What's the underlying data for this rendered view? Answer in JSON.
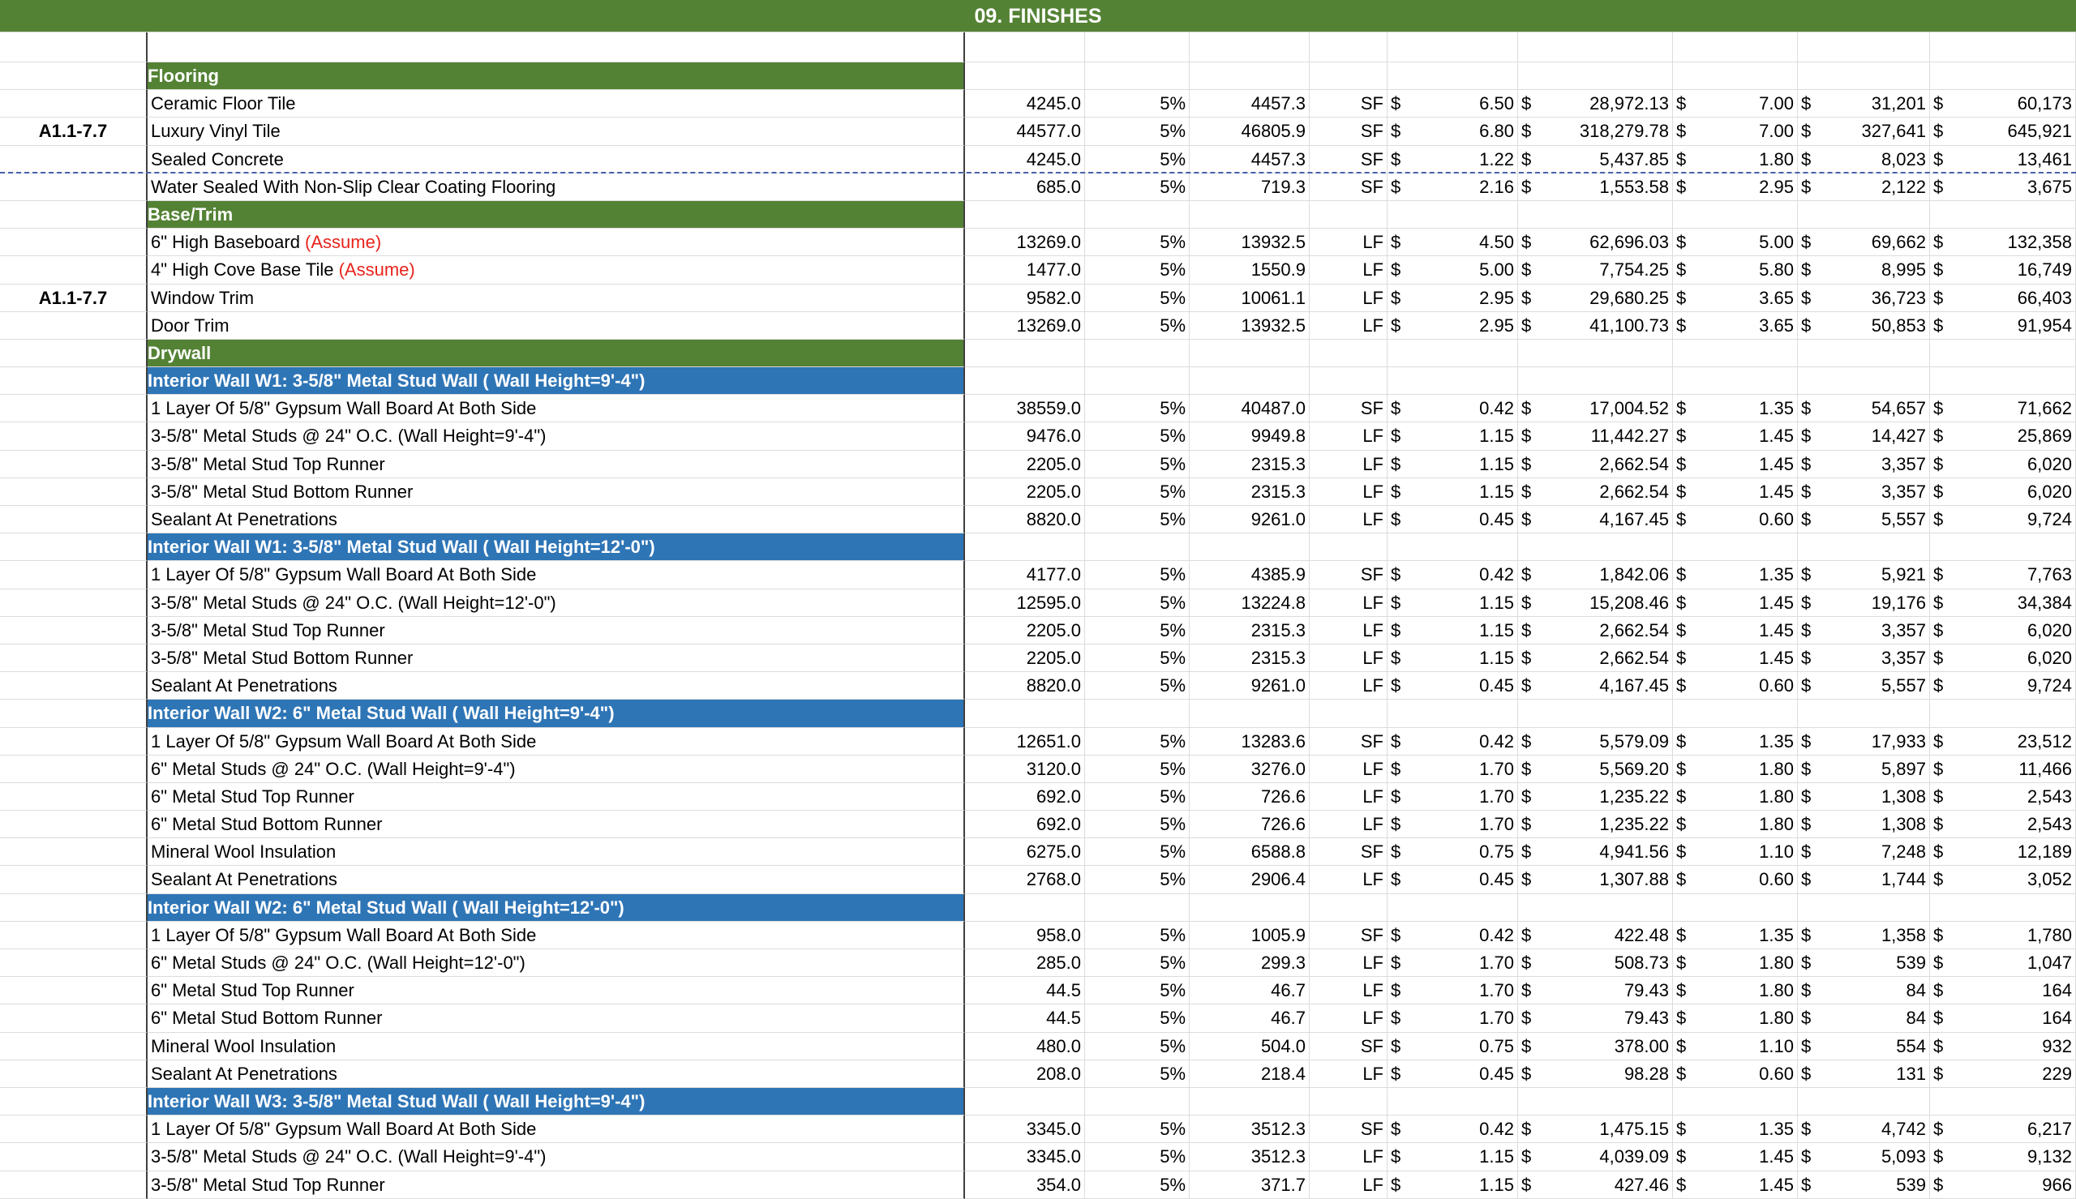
{
  "sheet_title": "09. FINISHES",
  "colors": {
    "section_header": "#548235",
    "subsection_header": "#2e75b6",
    "note": "#e8231b"
  },
  "rows": [
    {
      "kind": "cat",
      "label": "Flooring"
    },
    {
      "kind": "item",
      "ref": "",
      "label": "Ceramic Floor Tile",
      "note": "",
      "qty": "4245.0",
      "waste": "5%",
      "adj": "4457.3",
      "unit": "SF",
      "mat_rate": "6.50",
      "mat_total": "28,972.13",
      "lab_rate": "7.00",
      "lab_total": "31,201",
      "total": "60,173"
    },
    {
      "kind": "item",
      "ref": "A1.1-7.7",
      "label": "Luxury Vinyl Tile",
      "note": "",
      "qty": "44577.0",
      "waste": "5%",
      "adj": "46805.9",
      "unit": "SF",
      "mat_rate": "6.80",
      "mat_total": "318,279.78",
      "lab_rate": "7.00",
      "lab_total": "327,641",
      "total": "645,921"
    },
    {
      "kind": "item",
      "ref": "",
      "label": "Sealed Concrete",
      "note": "",
      "qty": "4245.0",
      "waste": "5%",
      "adj": "4457.3",
      "unit": "SF",
      "mat_rate": "1.22",
      "mat_total": "5,437.85",
      "lab_rate": "1.80",
      "lab_total": "8,023",
      "total": "13,461",
      "dash": true
    },
    {
      "kind": "item",
      "ref": "",
      "label": "Water Sealed With Non-Slip Clear Coating Flooring",
      "note": "",
      "qty": "685.0",
      "waste": "5%",
      "adj": "719.3",
      "unit": "SF",
      "mat_rate": "2.16",
      "mat_total": "1,553.58",
      "lab_rate": "2.95",
      "lab_total": "2,122",
      "total": "3,675"
    },
    {
      "kind": "cat",
      "label": "Base/Trim"
    },
    {
      "kind": "item",
      "ref": "",
      "label": "6\" High Baseboard ",
      "note": "(Assume)",
      "qty": "13269.0",
      "waste": "5%",
      "adj": "13932.5",
      "unit": "LF",
      "mat_rate": "4.50",
      "mat_total": "62,696.03",
      "lab_rate": "5.00",
      "lab_total": "69,662",
      "total": "132,358"
    },
    {
      "kind": "item",
      "ref": "",
      "label": "4\" High Cove Base Tile ",
      "note": "(Assume)",
      "qty": "1477.0",
      "waste": "5%",
      "adj": "1550.9",
      "unit": "LF",
      "mat_rate": "5.00",
      "mat_total": "7,754.25",
      "lab_rate": "5.80",
      "lab_total": "8,995",
      "total": "16,749"
    },
    {
      "kind": "item",
      "ref": "A1.1-7.7",
      "label": "Window Trim",
      "note": "",
      "qty": "9582.0",
      "waste": "5%",
      "adj": "10061.1",
      "unit": "LF",
      "mat_rate": "2.95",
      "mat_total": "29,680.25",
      "lab_rate": "3.65",
      "lab_total": "36,723",
      "total": "66,403"
    },
    {
      "kind": "item",
      "ref": "",
      "label": "Door Trim",
      "note": "",
      "qty": "13269.0",
      "waste": "5%",
      "adj": "13932.5",
      "unit": "LF",
      "mat_rate": "2.95",
      "mat_total": "41,100.73",
      "lab_rate": "3.65",
      "lab_total": "50,853",
      "total": "91,954"
    },
    {
      "kind": "cat",
      "label": "Drywall"
    },
    {
      "kind": "sub",
      "label": "Interior Wall W1: 3-5/8\" Metal Stud Wall ( Wall Height=9'-4\")"
    },
    {
      "kind": "item",
      "ref": "",
      "label": "1 Layer Of  5/8\" Gypsum Wall Board At Both Side",
      "note": "",
      "qty": "38559.0",
      "waste": "5%",
      "adj": "40487.0",
      "unit": "SF",
      "mat_rate": "0.42",
      "mat_total": "17,004.52",
      "lab_rate": "1.35",
      "lab_total": "54,657",
      "total": "71,662"
    },
    {
      "kind": "item",
      "ref": "",
      "label": "3-5/8\" Metal Studs @ 24\" O.C. (Wall Height=9'-4\")",
      "note": "",
      "qty": "9476.0",
      "waste": "5%",
      "adj": "9949.8",
      "unit": "LF",
      "mat_rate": "1.15",
      "mat_total": "11,442.27",
      "lab_rate": "1.45",
      "lab_total": "14,427",
      "total": "25,869"
    },
    {
      "kind": "item",
      "ref": "",
      "label": "3-5/8\" Metal Stud Top Runner",
      "note": "",
      "qty": "2205.0",
      "waste": "5%",
      "adj": "2315.3",
      "unit": "LF",
      "mat_rate": "1.15",
      "mat_total": "2,662.54",
      "lab_rate": "1.45",
      "lab_total": "3,357",
      "total": "6,020"
    },
    {
      "kind": "item",
      "ref": "",
      "label": "3-5/8\" Metal Stud Bottom Runner",
      "note": "",
      "qty": "2205.0",
      "waste": "5%",
      "adj": "2315.3",
      "unit": "LF",
      "mat_rate": "1.15",
      "mat_total": "2,662.54",
      "lab_rate": "1.45",
      "lab_total": "3,357",
      "total": "6,020"
    },
    {
      "kind": "item",
      "ref": "",
      "label": "Sealant At Penetrations",
      "note": "",
      "qty": "8820.0",
      "waste": "5%",
      "adj": "9261.0",
      "unit": "LF",
      "mat_rate": "0.45",
      "mat_total": "4,167.45",
      "lab_rate": "0.60",
      "lab_total": "5,557",
      "total": "9,724"
    },
    {
      "kind": "sub",
      "label": "Interior Wall W1: 3-5/8\" Metal Stud Wall ( Wall Height=12'-0\")"
    },
    {
      "kind": "item",
      "ref": "",
      "label": "1 Layer Of  5/8\" Gypsum Wall Board At Both Side",
      "note": "",
      "qty": "4177.0",
      "waste": "5%",
      "adj": "4385.9",
      "unit": "SF",
      "mat_rate": "0.42",
      "mat_total": "1,842.06",
      "lab_rate": "1.35",
      "lab_total": "5,921",
      "total": "7,763"
    },
    {
      "kind": "item",
      "ref": "",
      "label": "3-5/8\" Metal Studs @ 24\" O.C. (Wall Height=12'-0\")",
      "note": "",
      "qty": "12595.0",
      "waste": "5%",
      "adj": "13224.8",
      "unit": "LF",
      "mat_rate": "1.15",
      "mat_total": "15,208.46",
      "lab_rate": "1.45",
      "lab_total": "19,176",
      "total": "34,384"
    },
    {
      "kind": "item",
      "ref": "",
      "label": "3-5/8\" Metal Stud Top Runner",
      "note": "",
      "qty": "2205.0",
      "waste": "5%",
      "adj": "2315.3",
      "unit": "LF",
      "mat_rate": "1.15",
      "mat_total": "2,662.54",
      "lab_rate": "1.45",
      "lab_total": "3,357",
      "total": "6,020"
    },
    {
      "kind": "item",
      "ref": "",
      "label": "3-5/8\" Metal Stud Bottom Runner",
      "note": "",
      "qty": "2205.0",
      "waste": "5%",
      "adj": "2315.3",
      "unit": "LF",
      "mat_rate": "1.15",
      "mat_total": "2,662.54",
      "lab_rate": "1.45",
      "lab_total": "3,357",
      "total": "6,020"
    },
    {
      "kind": "item",
      "ref": "",
      "label": "Sealant At Penetrations",
      "note": "",
      "qty": "8820.0",
      "waste": "5%",
      "adj": "9261.0",
      "unit": "LF",
      "mat_rate": "0.45",
      "mat_total": "4,167.45",
      "lab_rate": "0.60",
      "lab_total": "5,557",
      "total": "9,724"
    },
    {
      "kind": "sub",
      "label": "Interior Wall W2: 6\" Metal Stud Wall ( Wall Height=9'-4\")"
    },
    {
      "kind": "item",
      "ref": "",
      "label": "1 Layer Of  5/8\" Gypsum Wall Board At Both Side",
      "note": "",
      "qty": "12651.0",
      "waste": "5%",
      "adj": "13283.6",
      "unit": "SF",
      "mat_rate": "0.42",
      "mat_total": "5,579.09",
      "lab_rate": "1.35",
      "lab_total": "17,933",
      "total": "23,512"
    },
    {
      "kind": "item",
      "ref": "",
      "label": "6\" Metal Studs @ 24\" O.C. (Wall Height=9'-4\")",
      "note": "",
      "qty": "3120.0",
      "waste": "5%",
      "adj": "3276.0",
      "unit": "LF",
      "mat_rate": "1.70",
      "mat_total": "5,569.20",
      "lab_rate": "1.80",
      "lab_total": "5,897",
      "total": "11,466"
    },
    {
      "kind": "item",
      "ref": "",
      "label": "6\" Metal Stud Top Runner",
      "note": "",
      "qty": "692.0",
      "waste": "5%",
      "adj": "726.6",
      "unit": "LF",
      "mat_rate": "1.70",
      "mat_total": "1,235.22",
      "lab_rate": "1.80",
      "lab_total": "1,308",
      "total": "2,543"
    },
    {
      "kind": "item",
      "ref": "",
      "label": "6\" Metal Stud Bottom Runner",
      "note": "",
      "qty": "692.0",
      "waste": "5%",
      "adj": "726.6",
      "unit": "LF",
      "mat_rate": "1.70",
      "mat_total": "1,235.22",
      "lab_rate": "1.80",
      "lab_total": "1,308",
      "total": "2,543"
    },
    {
      "kind": "item",
      "ref": "",
      "label": "Mineral Wool Insulation",
      "note": "",
      "qty": "6275.0",
      "waste": "5%",
      "adj": "6588.8",
      "unit": "SF",
      "mat_rate": "0.75",
      "mat_total": "4,941.56",
      "lab_rate": "1.10",
      "lab_total": "7,248",
      "total": "12,189"
    },
    {
      "kind": "item",
      "ref": "",
      "label": "Sealant At Penetrations",
      "note": "",
      "qty": "2768.0",
      "waste": "5%",
      "adj": "2906.4",
      "unit": "LF",
      "mat_rate": "0.45",
      "mat_total": "1,307.88",
      "lab_rate": "0.60",
      "lab_total": "1,744",
      "total": "3,052"
    },
    {
      "kind": "sub",
      "label": "Interior Wall W2: 6\" Metal Stud Wall ( Wall Height=12'-0\")"
    },
    {
      "kind": "item",
      "ref": "",
      "label": "1 Layer Of  5/8\" Gypsum Wall Board At Both Side",
      "note": "",
      "qty": "958.0",
      "waste": "5%",
      "adj": "1005.9",
      "unit": "SF",
      "mat_rate": "0.42",
      "mat_total": "422.48",
      "lab_rate": "1.35",
      "lab_total": "1,358",
      "total": "1,780"
    },
    {
      "kind": "item",
      "ref": "",
      "label": "6\" Metal Studs @ 24\" O.C. (Wall Height=12'-0\")",
      "note": "",
      "qty": "285.0",
      "waste": "5%",
      "adj": "299.3",
      "unit": "LF",
      "mat_rate": "1.70",
      "mat_total": "508.73",
      "lab_rate": "1.80",
      "lab_total": "539",
      "total": "1,047"
    },
    {
      "kind": "item",
      "ref": "",
      "label": "6\" Metal Stud Top Runner",
      "note": "",
      "qty": "44.5",
      "waste": "5%",
      "adj": "46.7",
      "unit": "LF",
      "mat_rate": "1.70",
      "mat_total": "79.43",
      "lab_rate": "1.80",
      "lab_total": "84",
      "total": "164"
    },
    {
      "kind": "item",
      "ref": "",
      "label": "6\" Metal Stud Bottom Runner",
      "note": "",
      "qty": "44.5",
      "waste": "5%",
      "adj": "46.7",
      "unit": "LF",
      "mat_rate": "1.70",
      "mat_total": "79.43",
      "lab_rate": "1.80",
      "lab_total": "84",
      "total": "164"
    },
    {
      "kind": "item",
      "ref": "",
      "label": "Mineral Wool Insulation",
      "note": "",
      "qty": "480.0",
      "waste": "5%",
      "adj": "504.0",
      "unit": "SF",
      "mat_rate": "0.75",
      "mat_total": "378.00",
      "lab_rate": "1.10",
      "lab_total": "554",
      "total": "932"
    },
    {
      "kind": "item",
      "ref": "",
      "label": "Sealant At Penetrations",
      "note": "",
      "qty": "208.0",
      "waste": "5%",
      "adj": "218.4",
      "unit": "LF",
      "mat_rate": "0.45",
      "mat_total": "98.28",
      "lab_rate": "0.60",
      "lab_total": "131",
      "total": "229"
    },
    {
      "kind": "sub",
      "label": "Interior Wall W3: 3-5/8\" Metal Stud Wall ( Wall Height=9'-4\")"
    },
    {
      "kind": "item",
      "ref": "",
      "label": "1 Layer Of  5/8\" Gypsum Wall Board At Both Side",
      "note": "",
      "qty": "3345.0",
      "waste": "5%",
      "adj": "3512.3",
      "unit": "SF",
      "mat_rate": "0.42",
      "mat_total": "1,475.15",
      "lab_rate": "1.35",
      "lab_total": "4,742",
      "total": "6,217"
    },
    {
      "kind": "item",
      "ref": "",
      "label": "3-5/8\" Metal Studs @ 24\" O.C. (Wall Height=9'-4\")",
      "note": "",
      "qty": "3345.0",
      "waste": "5%",
      "adj": "3512.3",
      "unit": "LF",
      "mat_rate": "1.15",
      "mat_total": "4,039.09",
      "lab_rate": "1.45",
      "lab_total": "5,093",
      "total": "9,132"
    },
    {
      "kind": "item",
      "ref": "",
      "label": "3-5/8\" Metal Stud Top Runner",
      "note": "",
      "qty": "354.0",
      "waste": "5%",
      "adj": "371.7",
      "unit": "LF",
      "mat_rate": "1.15",
      "mat_total": "427.46",
      "lab_rate": "1.45",
      "lab_total": "539",
      "total": "966"
    }
  ],
  "currency_symbol": "$"
}
